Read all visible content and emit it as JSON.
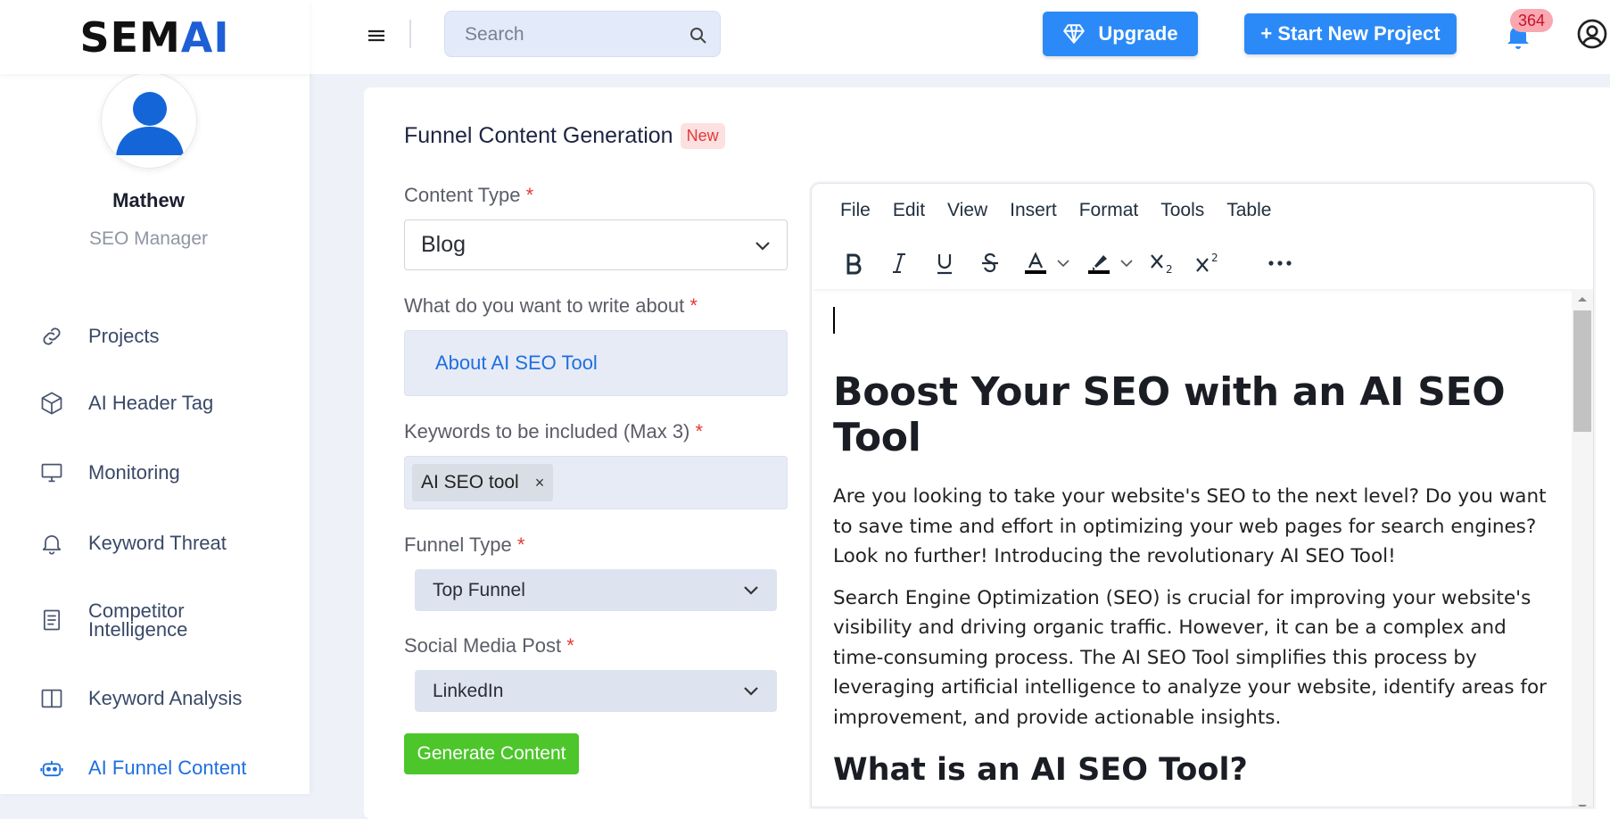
{
  "app": {
    "logo_main": "SEM",
    "logo_accent": "AI",
    "brand_color": "#1f5fd6"
  },
  "user": {
    "name": "Mathew",
    "role": "SEO Manager"
  },
  "sidebar": {
    "items": [
      {
        "label": "Projects",
        "icon": "link-icon"
      },
      {
        "label": "AI Header Tag",
        "icon": "cube-icon"
      },
      {
        "label": "Monitoring",
        "icon": "monitor-icon"
      },
      {
        "label": "Keyword Threat",
        "icon": "bell-icon"
      },
      {
        "label_line1": "Competitor",
        "label_line2": "Intelligence",
        "icon": "document-icon"
      },
      {
        "label": "Keyword Analysis",
        "icon": "columns-icon"
      },
      {
        "label": "AI Funnel Content",
        "icon": "robot-icon",
        "active": true
      }
    ]
  },
  "topbar": {
    "search_placeholder": "Search",
    "upgrade_label": "Upgrade",
    "new_project_label": "+ Start New Project",
    "notification_count": "364",
    "accent_color": "#2b8af7"
  },
  "form": {
    "title": "Funnel Content Generation",
    "badge": "New",
    "content_type": {
      "label": "Content Type",
      "required": "*",
      "value": "Blog"
    },
    "topic": {
      "label": "What do you want to write about",
      "required": "*",
      "value": "About AI SEO Tool"
    },
    "keywords": {
      "label": "Keywords to be included (Max 3)",
      "required": "*",
      "chips": [
        "AI SEO tool"
      ],
      "remove_glyph": "×"
    },
    "funnel_type": {
      "label": "Funnel Type",
      "required": "*",
      "value": "Top Funnel"
    },
    "social_media": {
      "label": "Social Media Post",
      "required": "*",
      "value": "LinkedIn"
    },
    "generate_label": "Generate Content",
    "generate_color": "#4cc62a"
  },
  "editor": {
    "menu": [
      "File",
      "Edit",
      "View",
      "Insert",
      "Format",
      "Tools",
      "Table"
    ],
    "toolbar": [
      "bold",
      "italic",
      "underline",
      "strikethrough",
      "text-color",
      "highlight",
      "subscript",
      "superscript",
      "more"
    ],
    "doc": {
      "h1": "Boost Your SEO with an AI SEO Tool",
      "p1": "Are you looking to take your website's SEO to the next level? Do you want to save time and effort in optimizing your web pages for search engines? Look no further! Introducing the revolutionary AI SEO Tool!",
      "p2": "Search Engine Optimization (SEO) is crucial for improving your website's visibility and driving organic traffic. However, it can be a complex and time-consuming process. The AI SEO Tool simplifies this process by leveraging artificial intelligence to analyze your website, identify areas for improvement, and provide actionable insights.",
      "h2": "What is an AI SEO Tool?"
    }
  }
}
